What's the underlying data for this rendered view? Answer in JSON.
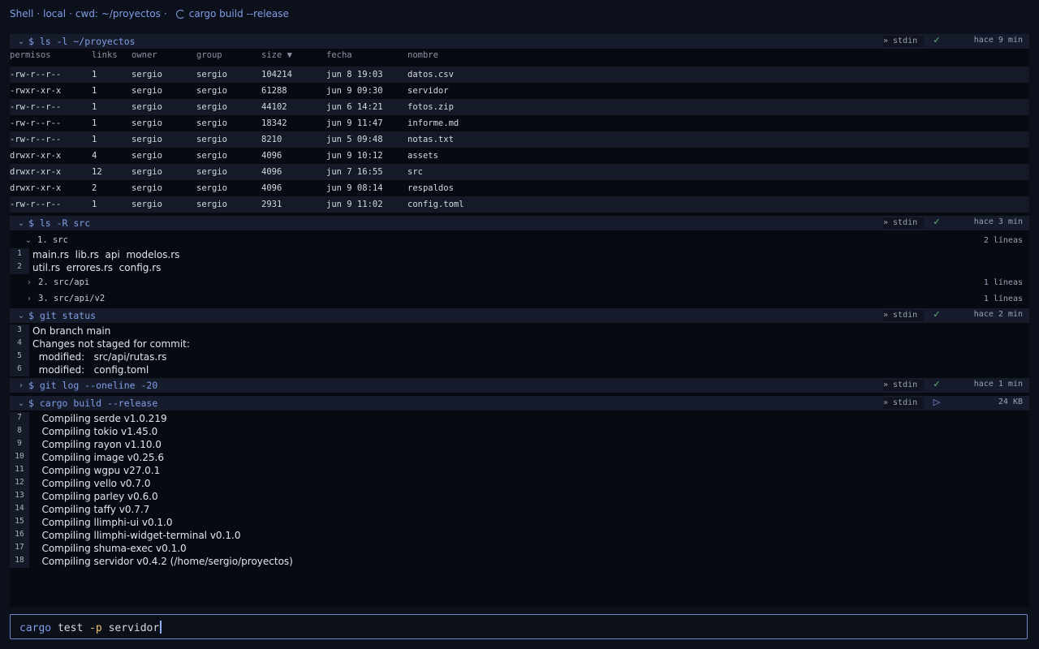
{
  "header": {
    "shell": "Shell",
    "location": "local",
    "cwd": "cwd: ~/proyectos",
    "running": "cargo build --release",
    "sep": "·"
  },
  "blocks": {
    "ls": {
      "command": "$ ls -l ~/proyectos",
      "stdin": "» stdin",
      "status": "✓",
      "time": "hace 9 min",
      "columns": [
        "permisos",
        "links",
        "owner",
        "group",
        "size ▼",
        "fecha",
        "nombre"
      ],
      "rows": [
        [
          "-rw-r--r--",
          "1",
          "sergio",
          "sergio",
          "104214",
          "jun 8 19:03",
          "datos.csv"
        ],
        [
          "-rwxr-xr-x",
          "1",
          "sergio",
          "sergio",
          "61288",
          "jun 9 09:30",
          "servidor"
        ],
        [
          "-rw-r--r--",
          "1",
          "sergio",
          "sergio",
          "44102",
          "jun 6 14:21",
          "fotos.zip"
        ],
        [
          "-rw-r--r--",
          "1",
          "sergio",
          "sergio",
          "18342",
          "jun 9 11:47",
          "informe.md"
        ],
        [
          "-rw-r--r--",
          "1",
          "sergio",
          "sergio",
          "8210",
          "jun 5 09:48",
          "notas.txt"
        ],
        [
          "drwxr-xr-x",
          "4",
          "sergio",
          "sergio",
          "4096",
          "jun 9 10:12",
          "assets"
        ],
        [
          "drwxr-xr-x",
          "12",
          "sergio",
          "sergio",
          "4096",
          "jun 7 16:55",
          "src"
        ],
        [
          "drwxr-xr-x",
          "2",
          "sergio",
          "sergio",
          "4096",
          "jun 9 08:14",
          "respaldos"
        ],
        [
          "-rw-r--r--",
          "1",
          "sergio",
          "sergio",
          "2931",
          "jun 9 11:02",
          "config.toml"
        ]
      ]
    },
    "lsr": {
      "command": "$ ls -R src",
      "stdin": "» stdin",
      "status": "✓",
      "time": "hace 3 min",
      "groups": [
        {
          "title": "1. src",
          "count": "2 líneas",
          "lines": [
            {
              "n": "1",
              "text": "main.rs  lib.rs  api  modelos.rs"
            },
            {
              "n": "2",
              "text": "util.rs  errores.rs  config.rs"
            }
          ]
        },
        {
          "title": "2. src/api",
          "count": "1 líneas"
        },
        {
          "title": "3. src/api/v2",
          "count": "1 líneas"
        }
      ]
    },
    "git_status": {
      "command": "$ git status",
      "stdin": "» stdin",
      "status": "✓",
      "time": "hace 2 min",
      "lines": [
        {
          "n": "3",
          "text": "On branch main"
        },
        {
          "n": "4",
          "text": "Changes not staged for commit:"
        },
        {
          "n": "5",
          "text": "  modified:   src/api/rutas.rs"
        },
        {
          "n": "6",
          "text": "  modified:   config.toml"
        }
      ]
    },
    "git_log": {
      "command": "$ git log --oneline -20",
      "stdin": "» stdin",
      "status": "✓",
      "time": "hace 1 min"
    },
    "cargo": {
      "command": "$ cargo build --release",
      "stdin": "» stdin",
      "status": "▷",
      "time": "24 KB",
      "lines": [
        {
          "n": "7",
          "text": "   Compiling serde v1.0.219"
        },
        {
          "n": "8",
          "text": "   Compiling tokio v1.45.0"
        },
        {
          "n": "9",
          "text": "   Compiling rayon v1.10.0"
        },
        {
          "n": "10",
          "text": "   Compiling image v0.25.6"
        },
        {
          "n": "11",
          "text": "   Compiling wgpu v27.0.1"
        },
        {
          "n": "12",
          "text": "   Compiling vello v0.7.0"
        },
        {
          "n": "13",
          "text": "   Compiling parley v0.6.0"
        },
        {
          "n": "14",
          "text": "   Compiling taffy v0.7.7"
        },
        {
          "n": "15",
          "text": "   Compiling llimphi-ui v0.1.0"
        },
        {
          "n": "16",
          "text": "   Compiling llimphi-widget-terminal v0.1.0"
        },
        {
          "n": "17",
          "text": "   Compiling shuma-exec v0.1.0"
        },
        {
          "n": "18",
          "text": "   Compiling servidor v0.4.2 (/home/sergio/proyectos)"
        }
      ]
    }
  },
  "input": {
    "cmd": "cargo",
    "arg1": " test ",
    "flag": "-p",
    "arg2": " servidor"
  }
}
